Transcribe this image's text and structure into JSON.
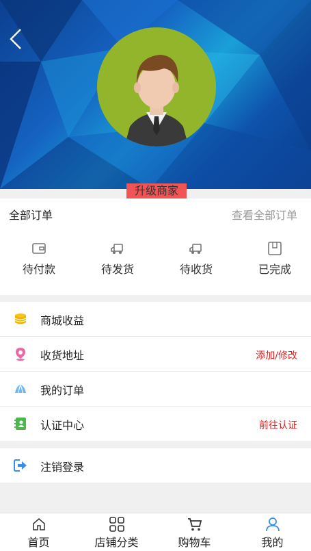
{
  "profile": {
    "upgrade_label": "升级商家"
  },
  "orders": {
    "title": "全部订单",
    "view_all": "查看全部订单",
    "statuses": [
      {
        "label": "待付款",
        "icon": "wallet-icon"
      },
      {
        "label": "待发货",
        "icon": "truck-icon"
      },
      {
        "label": "待收货",
        "icon": "truck-icon"
      },
      {
        "label": "已完成",
        "icon": "box-icon"
      }
    ]
  },
  "menu": {
    "items": [
      {
        "label": "商城收益",
        "icon": "coins-icon",
        "action": ""
      },
      {
        "label": "收货地址",
        "icon": "location-pin-icon",
        "action": "添加/修改"
      },
      {
        "label": "我的订单",
        "icon": "orders-icon",
        "action": ""
      },
      {
        "label": "认证中心",
        "icon": "id-card-icon",
        "action": "前往认证"
      }
    ],
    "logout_label": "注销登录"
  },
  "tabbar": {
    "tabs": [
      {
        "label": "首页",
        "icon": "home-icon"
      },
      {
        "label": "店铺分类",
        "icon": "grid-icon"
      },
      {
        "label": "购物车",
        "icon": "cart-icon"
      },
      {
        "label": "我的",
        "icon": "user-icon"
      }
    ]
  },
  "colors": {
    "accent_red": "#e02020",
    "upgrade_bg": "#f05454",
    "avatar_bg": "#93b52b",
    "icon_blue": "#3a8ee6"
  }
}
